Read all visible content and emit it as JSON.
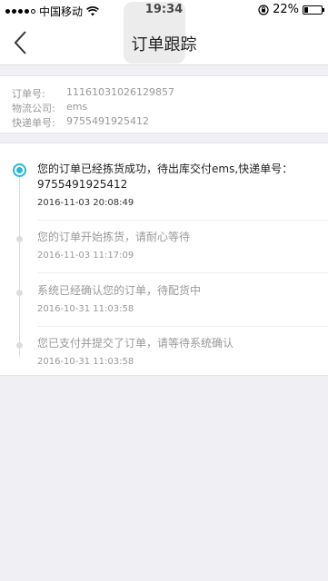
{
  "status_bar": {
    "carrier": "中国移动",
    "time": "19:34",
    "battery": "22%",
    "battery_level": 0.22
  },
  "nav": {
    "title": "订单跟踪"
  },
  "order_info": {
    "rows": [
      {
        "label": "订单号:",
        "value": "11161031026129857"
      },
      {
        "label": "物流公司:",
        "value": "ems"
      },
      {
        "label": "快递单号:",
        "value": "9755491925412"
      }
    ]
  },
  "tracking": {
    "steps": [
      {
        "message": "您的订单已经拣货成功，待出库交付ems,快递单号：9755491925412",
        "time": "2016-11-03 20:08:49",
        "active": true
      },
      {
        "message": "您的订单开始拣货，请耐心等待",
        "time": "2016-11-03 11:17:09",
        "active": false
      },
      {
        "message": "系统已经确认您的订单，待配货中",
        "time": "2016-10-31 11:03:58",
        "active": false
      },
      {
        "message": "您已支付并提交了订单，请等待系统确认",
        "time": "2016-10-31 11:03:58",
        "active": false
      }
    ]
  },
  "colors": {
    "accent": "#28b7d8",
    "background": "#efeff4"
  }
}
